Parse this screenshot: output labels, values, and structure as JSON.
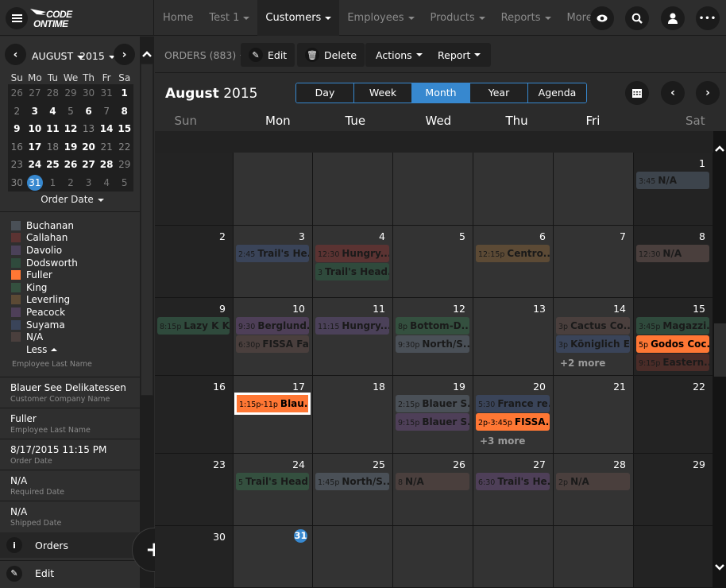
{
  "app": {
    "logo_line1": "CODE",
    "logo_line2": "ONTIME"
  },
  "nav": {
    "items": [
      {
        "label": "Home",
        "caret": false,
        "active": false
      },
      {
        "label": "Test 1",
        "caret": true,
        "active": false
      },
      {
        "label": "Customers",
        "caret": true,
        "active": true
      },
      {
        "label": "Employees",
        "caret": true,
        "active": false
      },
      {
        "label": "Products",
        "caret": true,
        "active": false
      },
      {
        "label": "Reports",
        "caret": true,
        "active": false
      },
      {
        "label": "More",
        "caret": true,
        "active": false
      }
    ],
    "icons": [
      "eye-icon",
      "search-icon",
      "user-icon",
      "more-icon"
    ]
  },
  "mini_calendar": {
    "month": "AUGUST",
    "year": "2015",
    "dow": [
      "Su",
      "Mo",
      "Tu",
      "We",
      "Th",
      "Fr",
      "Sa"
    ],
    "days": [
      {
        "d": "26",
        "s": "o"
      },
      {
        "d": "27",
        "s": "o"
      },
      {
        "d": "28",
        "s": "o"
      },
      {
        "d": "29",
        "s": "o"
      },
      {
        "d": "30",
        "s": "o"
      },
      {
        "d": "31",
        "s": "o"
      },
      {
        "d": "1",
        "s": "b"
      },
      {
        "d": "2",
        "s": ""
      },
      {
        "d": "3",
        "s": "b"
      },
      {
        "d": "4",
        "s": "b"
      },
      {
        "d": "5",
        "s": ""
      },
      {
        "d": "6",
        "s": "b"
      },
      {
        "d": "7",
        "s": ""
      },
      {
        "d": "8",
        "s": "b"
      },
      {
        "d": "9",
        "s": "b"
      },
      {
        "d": "10",
        "s": "b"
      },
      {
        "d": "11",
        "s": "b"
      },
      {
        "d": "12",
        "s": "b"
      },
      {
        "d": "13",
        "s": ""
      },
      {
        "d": "14",
        "s": "b"
      },
      {
        "d": "15",
        "s": "b"
      },
      {
        "d": "16",
        "s": ""
      },
      {
        "d": "17",
        "s": "b"
      },
      {
        "d": "18",
        "s": ""
      },
      {
        "d": "19",
        "s": "b"
      },
      {
        "d": "20",
        "s": "b"
      },
      {
        "d": "21",
        "s": ""
      },
      {
        "d": "22",
        "s": ""
      },
      {
        "d": "23",
        "s": ""
      },
      {
        "d": "24",
        "s": "b"
      },
      {
        "d": "25",
        "s": "b"
      },
      {
        "d": "26",
        "s": "b"
      },
      {
        "d": "27",
        "s": "b"
      },
      {
        "d": "28",
        "s": "b"
      },
      {
        "d": "29",
        "s": ""
      },
      {
        "d": "30",
        "s": ""
      },
      {
        "d": "31",
        "s": "today"
      },
      {
        "d": "1",
        "s": "o"
      },
      {
        "d": "2",
        "s": "o"
      },
      {
        "d": "3",
        "s": "o"
      },
      {
        "d": "4",
        "s": "o"
      },
      {
        "d": "5",
        "s": "o"
      }
    ],
    "field_label": "Order Date"
  },
  "legend": {
    "items": [
      {
        "name": "Buchanan",
        "color": "#4a5057"
      },
      {
        "name": "Callahan",
        "color": "#5b3332"
      },
      {
        "name": "Davolio",
        "color": "#4b4159"
      },
      {
        "name": "Dodsworth",
        "color": "#2f4a3c"
      },
      {
        "name": "Fuller",
        "color": "#ff7734"
      },
      {
        "name": "King",
        "color": "#34503f"
      },
      {
        "name": "Leverling",
        "color": "#5c4a35"
      },
      {
        "name": "Peacock",
        "color": "#4e3f58"
      },
      {
        "name": "Suyama",
        "color": "#3a4459"
      },
      {
        "name": "N/A",
        "color": "#4a3f3d"
      }
    ],
    "less_label": "Less",
    "caption": "Employee Last Name"
  },
  "details": [
    {
      "value": "Blauer See Delikatessen",
      "label": "Customer Company Name"
    },
    {
      "value": "Fuller",
      "label": "Employee Last Name"
    },
    {
      "value": "8/17/2015 11:15 PM",
      "label": "Order Date"
    },
    {
      "value": "N/A",
      "label": "Required Date"
    },
    {
      "value": "N/A",
      "label": "Shipped Date"
    }
  ],
  "side_actions": {
    "orders_label": "Orders",
    "edit_label": "Edit"
  },
  "toolbar": {
    "title": "ORDERS (883)",
    "edit_label": "Edit",
    "delete_label": "Delete",
    "actions_label": "Actions",
    "report_label": "Report"
  },
  "calendar": {
    "month_name": "August",
    "year": "2015",
    "views": [
      {
        "label": "Day",
        "active": false
      },
      {
        "label": "Week",
        "active": false
      },
      {
        "label": "Month",
        "active": true
      },
      {
        "label": "Year",
        "active": false
      },
      {
        "label": "Agenda",
        "active": false
      }
    ],
    "dow": [
      "Sun",
      "Mon",
      "Tue",
      "Wed",
      "Thu",
      "Fri",
      "Sat"
    ],
    "weeks": [
      [
        {
          "day": ""
        },
        {
          "day": ""
        },
        {
          "day": ""
        },
        {
          "day": ""
        },
        {
          "day": ""
        },
        {
          "day": ""
        },
        {
          "day": "1",
          "events": [
            {
              "time": "3:45",
              "title": "N/A",
              "color": "#3d444c"
            }
          ]
        }
      ],
      [
        {
          "day": "2"
        },
        {
          "day": "3",
          "events": [
            {
              "time": "2:45",
              "title": "Trail's He...",
              "color": "#3a4459"
            }
          ]
        },
        {
          "day": "4",
          "events": [
            {
              "time": "12:30",
              "title": "Hungry...",
              "color": "#5b3332"
            },
            {
              "time": "3",
              "title": "Trail's Head...",
              "color": "#2f4a3c"
            }
          ]
        },
        {
          "day": "5"
        },
        {
          "day": "6",
          "events": [
            {
              "time": "12:15p",
              "title": "Centro...",
              "color": "#5c4a35"
            }
          ]
        },
        {
          "day": "7"
        },
        {
          "day": "8",
          "events": [
            {
              "time": "12:30",
              "title": "N/A",
              "color": "#4a3f3d"
            }
          ]
        }
      ],
      [
        {
          "day": "9",
          "events": [
            {
              "time": "8:15p",
              "title": "Lazy K K...",
              "color": "#2f4a3c"
            }
          ]
        },
        {
          "day": "10",
          "events": [
            {
              "time": "9:30",
              "title": "Berglund...",
              "color": "#4e3f58"
            },
            {
              "time": "6:30p",
              "title": "FISSA Fa...",
              "color": "#4a3f3d"
            }
          ]
        },
        {
          "day": "11",
          "events": [
            {
              "time": "11:15",
              "title": "Hungry...",
              "color": "#4b4159"
            }
          ]
        },
        {
          "day": "12",
          "events": [
            {
              "time": "8p",
              "title": "Bottom-D...",
              "color": "#34503f"
            },
            {
              "time": "9:30p",
              "title": "North/S...",
              "color": "#4a5057"
            }
          ]
        },
        {
          "day": "13"
        },
        {
          "day": "14",
          "events": [
            {
              "time": "3p",
              "title": "Cactus Co...",
              "color": "#4a3f3d"
            },
            {
              "time": "3p",
              "title": "Königlich E...",
              "color": "#3a4459"
            }
          ],
          "more": "+2 more"
        },
        {
          "day": "15",
          "events": [
            {
              "time": "3:45p",
              "title": "Magazzi...",
              "color": "#2f4a3c"
            },
            {
              "time": "5p",
              "title": "Godos Coc...",
              "color": "#ff7734",
              "bright": true
            },
            {
              "time": "9:15p",
              "title": "Eastern...",
              "color": "#4a2c28"
            }
          ]
        }
      ],
      [
        {
          "day": "16"
        },
        {
          "day": "17",
          "events": [
            {
              "time": "1:15p-11p",
              "title": "Blau...",
              "color": "#ff7734",
              "bright": true,
              "selected": true
            }
          ]
        },
        {
          "day": "18"
        },
        {
          "day": "19",
          "events": [
            {
              "time": "2:15p",
              "title": "Blauer S...",
              "color": "#4a5057"
            },
            {
              "time": "9:15p",
              "title": "Blauer S...",
              "color": "#4e3f58"
            }
          ]
        },
        {
          "day": "20",
          "events": [
            {
              "time": "5:30",
              "title": "France re...",
              "color": "#3a4459"
            },
            {
              "time": "2p-3:45p",
              "title": "FISSA...",
              "color": "#ff7734",
              "bright": true
            }
          ],
          "more": "+3 more"
        },
        {
          "day": "21"
        },
        {
          "day": "22"
        }
      ],
      [
        {
          "day": "23"
        },
        {
          "day": "24",
          "events": [
            {
              "time": "5",
              "title": "Trail's Head...",
              "color": "#34503f"
            }
          ]
        },
        {
          "day": "25",
          "events": [
            {
              "time": "1:45p",
              "title": "North/S...",
              "color": "#4a5057"
            }
          ]
        },
        {
          "day": "26",
          "events": [
            {
              "time": "8",
              "title": "N/A",
              "color": "#4a3f3d"
            }
          ]
        },
        {
          "day": "27",
          "events": [
            {
              "time": "6:30",
              "title": "Trail's He...",
              "color": "#4e3f58"
            }
          ]
        },
        {
          "day": "28",
          "events": [
            {
              "time": "2p",
              "title": "N/A",
              "color": "#4a3f3d"
            }
          ]
        },
        {
          "day": "29"
        }
      ],
      [
        {
          "day": "30"
        },
        {
          "day": "31",
          "today": true
        },
        {
          "day": ""
        },
        {
          "day": ""
        },
        {
          "day": ""
        },
        {
          "day": ""
        },
        {
          "day": ""
        }
      ]
    ]
  }
}
